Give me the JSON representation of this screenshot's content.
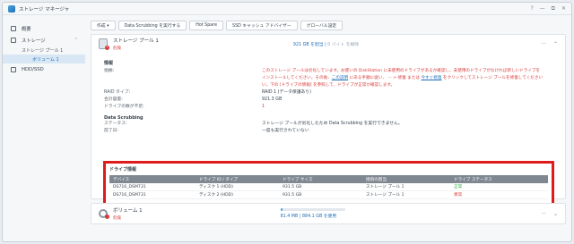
{
  "window": {
    "title": "ストレージ マネージャ",
    "controls": [
      "?",
      "—",
      "⧉",
      "✕"
    ]
  },
  "sidebar": {
    "items": [
      {
        "label": "概要"
      },
      {
        "label": "ストレージ",
        "chevron": "⌃"
      },
      {
        "label": "HDD/SSD"
      }
    ],
    "subitems": [
      {
        "label": "ストレージ プール 1"
      },
      {
        "label": "ボリューム 1"
      }
    ]
  },
  "toolbar": [
    {
      "label": "作成 ▾"
    },
    {
      "label": "Data Scrubbing を実行する"
    },
    {
      "label": "Hot Spare"
    },
    {
      "label": "SSD キャッシュ アドバイザー"
    },
    {
      "label": "グローバル設定"
    }
  ],
  "pool": {
    "name": "ストレージ プール 1",
    "status": "危険",
    "capacity_used": "921 GB を割当",
    "capacity_free": "0 バイト を解除",
    "controls": [
      "···",
      "⌃"
    ],
    "info_title": "情報",
    "notice_label": "指摘:",
    "notice_1": "このストレージ プールは劣化しています。お使いの DiskStation に未使用のドライブがあるか確認し、未使用のドライブがなければ新しいドライブを",
    "notice_2_pre": "インストールしてください。その後、",
    "notice_link_1": "この説明",
    "notice_2_mid": " にある手順に従い、 ··· > 修復 または ",
    "notice_link_2": "今すぐ修復",
    "notice_2_post": " をクリックしてストレージ プールを修復してください",
    "notice_3": "い。下の [ドライブの情報] を参照して、ドライブが正常か確認します。",
    "raid_label": "RAID タイプ:",
    "raid_value": "RAID 1 (データ保護あり)",
    "total_label": "合計容量:",
    "total_value": "921.3 GB",
    "missing_label": "ドライブの数が不足:",
    "missing_value": "1",
    "scrub_title": "Data Scrubbing",
    "scrub_status_label": "ステータス:",
    "scrub_status_value": "ストレージ プールが劣化したため Data Scrubbing を実行できません。",
    "scrub_last_label": "前了日:",
    "scrub_last_value": "一度も実行されていない"
  },
  "drives": {
    "title": "ドライブ情報",
    "headers": [
      "デバイス",
      "ドライブ ID / タイプ",
      "ドライブ サイズ",
      "接続の割当",
      "ドライブ ステータス"
    ],
    "rows": [
      [
        "DS716_DSM731",
        "ディスク 1 (HDD)",
        "931.5 GB",
        "ストレージ プール 1",
        "正常"
      ],
      [
        "DS716_DSM731",
        "ディスク 2 (HDD)",
        "931.5 GB",
        "ストレージ プール 1",
        "異常"
      ]
    ]
  },
  "volume": {
    "name": "ボリューム 1",
    "status": "危険",
    "capacity_used": "81.4 MB",
    "capacity_total": "| 884.1 GB を使用",
    "usage_fraction": 0.03,
    "controls": [
      "···",
      "⌄"
    ]
  }
}
